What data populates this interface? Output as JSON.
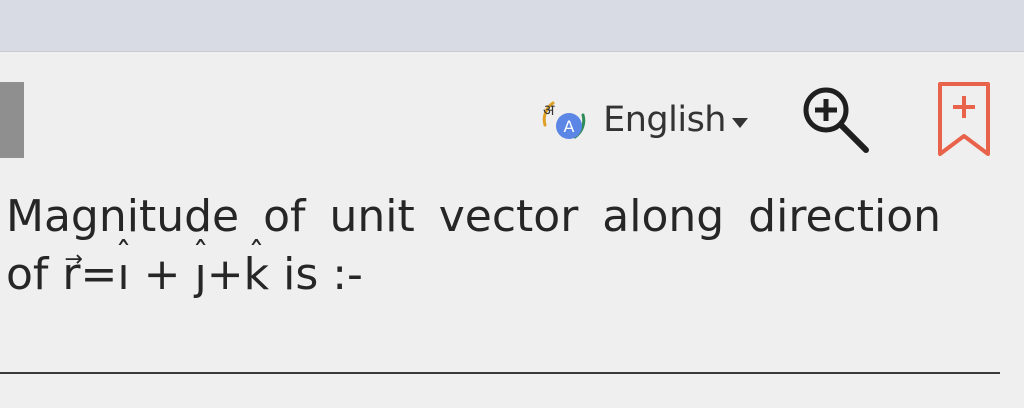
{
  "toolbar": {
    "language_icon_text": "अ",
    "language_icon_letter": "A",
    "language_label": "English",
    "colors": {
      "language_badge": "#5b86e5",
      "bookmark": "#e8634a",
      "zoom": "#1f1f1f"
    }
  },
  "question": {
    "line1": "Magnitude of unit vector along direction",
    "line2_prefix": "of",
    "vector_letter": "r",
    "vector_arrow": "⃗",
    "equals": "=",
    "i_letter": "ı",
    "j_letter": "ȷ",
    "k_letter": "k",
    "hat": "ˆ",
    "plus": "+",
    "suffix": "is :-"
  }
}
